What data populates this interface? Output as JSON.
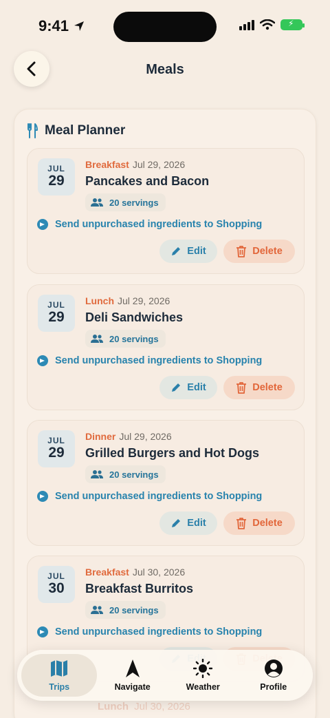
{
  "status": {
    "time": "9:41"
  },
  "header": {
    "title": "Meals"
  },
  "planner": {
    "title": "Meal Planner",
    "send_label": "Send unpurchased ingredients to Shopping",
    "edit_label": "Edit",
    "delete_label": "Delete",
    "meals": [
      {
        "month": "JUL",
        "day": "29",
        "type": "Breakfast",
        "date": "Jul 29, 2026",
        "name": "Pancakes and Bacon",
        "servings": "20 servings"
      },
      {
        "month": "JUL",
        "day": "29",
        "type": "Lunch",
        "date": "Jul 29, 2026",
        "name": "Deli Sandwiches",
        "servings": "20 servings"
      },
      {
        "month": "JUL",
        "day": "29",
        "type": "Dinner",
        "date": "Jul 29, 2026",
        "name": "Grilled Burgers and Hot Dogs",
        "servings": "20 servings"
      },
      {
        "month": "JUL",
        "day": "30",
        "type": "Breakfast",
        "date": "Jul 30, 2026",
        "name": "Breakfast Burritos",
        "servings": "20 servings"
      }
    ],
    "next_peek": {
      "type": "Lunch",
      "date": "Jul 30, 2026"
    }
  },
  "tabs": [
    {
      "label": "Trips",
      "icon": "map-icon",
      "active": true
    },
    {
      "label": "Navigate",
      "icon": "navigation-arrow-icon",
      "active": false
    },
    {
      "label": "Weather",
      "icon": "sun-icon",
      "active": false
    },
    {
      "label": "Profile",
      "icon": "person-icon",
      "active": false
    }
  ],
  "colors": {
    "accent": "#2a80aa",
    "meal_type": "#e06a3d",
    "background": "#f6ede3"
  }
}
